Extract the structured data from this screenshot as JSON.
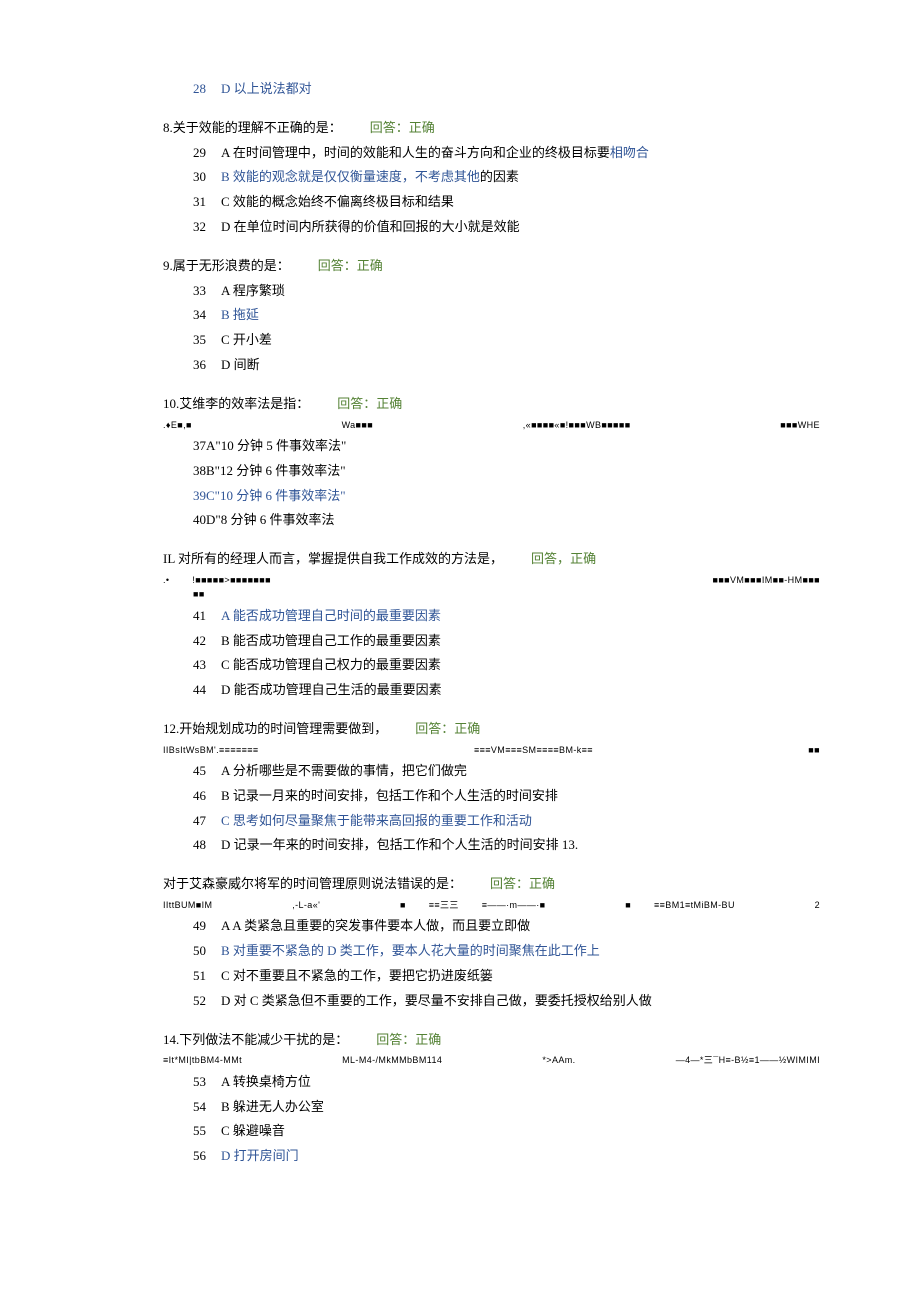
{
  "leading_option": {
    "num": "28",
    "letter": "D",
    "text": "以上说法都对"
  },
  "questions": [
    {
      "title": "8.关于效能的理解不正确的是：",
      "answer_label": "回答：",
      "answer_val": "正确",
      "gibberish": null,
      "options": [
        {
          "num": "29",
          "letter": "A",
          "text": "在时间管理中，时间的效能和人生的奋斗方向和企业的终极目标要",
          "tail": "相吻合",
          "is_blue": false,
          "tail_blue": true
        },
        {
          "num": "30",
          "letter": "B",
          "text": "效能的观念就是仅仅衡量速度，不考虑其他",
          "tail": "的因素",
          "is_blue": true,
          "tail_blue": false
        },
        {
          "num": "31",
          "letter": "C",
          "text": "效能的概念始终不偏离终极目标和结果",
          "is_blue": false
        },
        {
          "num": "32",
          "letter": "D",
          "text": "在单位时间内所获得的价值和回报的大小就是效能",
          "is_blue": false
        }
      ]
    },
    {
      "title": "9.属于无形浪费的是：",
      "answer_label": "回答：",
      "answer_val": "正确",
      "gibberish": null,
      "options": [
        {
          "num": "33",
          "letter": "A",
          "text": "程序繁琐",
          "is_blue": false
        },
        {
          "num": "34",
          "letter": "B",
          "text": "拖延",
          "is_blue": true
        },
        {
          "num": "35",
          "letter": "C",
          "text": "开小差",
          "is_blue": false
        },
        {
          "num": "36",
          "letter": "D",
          "text": "间断",
          "is_blue": false
        }
      ]
    },
    {
      "title": "10.艾维李的效率法是指：",
      "answer_label": "回答：",
      "answer_val": "正确",
      "gibberish": [
        ".♦E■,■",
        "Wa■■■",
        ",«■■■■«■!■■■WB■■■■■",
        "■■■WHE"
      ],
      "inline_options": true,
      "options": [
        {
          "num": "37",
          "letter": "A",
          "text": "\"10 分钟 5 件事效率法\"",
          "is_blue": false
        },
        {
          "num": "38",
          "letter": "B",
          "text": "\"12 分钟 6 件事效率法\"",
          "is_blue": false
        },
        {
          "num": "39",
          "letter": "C",
          "text": "\"10 分钟 6 件事效率法\"",
          "is_blue": true
        },
        {
          "num": "40",
          "letter": "D",
          "text": "\"8 分钟 6 件事效率法",
          "is_blue": false
        }
      ]
    },
    {
      "title": "IL 对所有的经理人而言，掌握提供自我工作成效的方法是，",
      "answer_label": "回答，",
      "answer_val": "正确",
      "gibberish": [
        ".•  !■■■■■>■■■■■■■",
        "■■■VM■■■IM■■-HM■■■"
      ],
      "gibberish2": [
        "■■"
      ],
      "options": [
        {
          "num": "41",
          "letter": "A",
          "text": "能否成功管理自己时间的最重要因素",
          "is_blue": true
        },
        {
          "num": "42",
          "letter": "B",
          "text": "能否成功管理自己工作的最重要因素",
          "is_blue": false
        },
        {
          "num": "43",
          "letter": "C",
          "text": "能否成功管理自己权力的最重要因素",
          "is_blue": false
        },
        {
          "num": "44",
          "letter": "D",
          "text": "能否成功管理自己生活的最重要因素",
          "is_blue": false
        }
      ]
    },
    {
      "title": "12.开始规划成功的时间管理需要做到，",
      "answer_label": "回答：",
      "answer_val": "正确",
      "gibberish": [
        "IIBsItWsBM'.≡≡≡≡≡≡≡",
        "≡≡≡VM≡≡≡SM≡≡≡≡BM-k≡≡",
        "■■"
      ],
      "options": [
        {
          "num": "45",
          "letter": "A",
          "text": "分析哪些是不需要做的事情，把它们做完",
          "is_blue": false
        },
        {
          "num": "46",
          "letter": "B",
          "text": "记录一月来的时间安排，包括工作和个人生活的时间安排",
          "is_blue": false
        },
        {
          "num": "47",
          "letter": "C",
          "text": "思考如何尽量聚焦于能带来高回报的重要工作和活动",
          "is_blue": true
        },
        {
          "num": "48",
          "letter": "D",
          "text": "记录一年来的时间安排，包括工作和个人生活的时间安排 13.",
          "is_blue": false
        }
      ]
    },
    {
      "title": "对于艾森豪威尔将军的时间管理原则说法错误的是：",
      "answer_label": "回答：",
      "answer_val": "正确",
      "gibberish": [
        "IIttBUM■IM",
        ",-L-a«'",
        "■  ≡≡三三   ≡——·m——·■",
        "■   ≡≡BM1≡tMiBM-BU",
        "2"
      ],
      "options": [
        {
          "num": "49",
          "letter": "A",
          "text": "A 类紧急且重要的突发事件要本人做，而且要立即做",
          "is_blue": false
        },
        {
          "num": "50",
          "letter": "B",
          "text": "对重要不紧急的 D 类工作，要本人花大量的时间聚焦在此工作上",
          "is_blue": true
        },
        {
          "num": "51",
          "letter": "C",
          "text": "对不重要且不紧急的工作，要把它扔进废纸篓",
          "is_blue": false
        },
        {
          "num": "52",
          "letter": "D",
          "text": "对 C 类紧急但不重要的工作，要尽量不安排自己做，要委托授权给别人做",
          "is_blue": false
        }
      ]
    },
    {
      "title": "14.下列做法不能减少干扰的是：",
      "answer_label": "回答：",
      "answer_val": "正确",
      "gibberish": [
        "≡It*MI|tbBM4-MMt",
        "ML-M4-/MkMMbBM114",
        "*>AAm.",
        "—4—*三¯H≡-B½≡1——½WIMIMI"
      ],
      "options": [
        {
          "num": "53",
          "letter": "A",
          "text": "转换桌椅方位",
          "is_blue": false
        },
        {
          "num": "54",
          "letter": "B",
          "text": "躲进无人办公室",
          "is_blue": false
        },
        {
          "num": "55",
          "letter": "C",
          "text": "躲避噪音",
          "is_blue": false
        },
        {
          "num": "56",
          "letter": "D",
          "text": "打开房间门",
          "is_blue": true
        }
      ]
    }
  ]
}
